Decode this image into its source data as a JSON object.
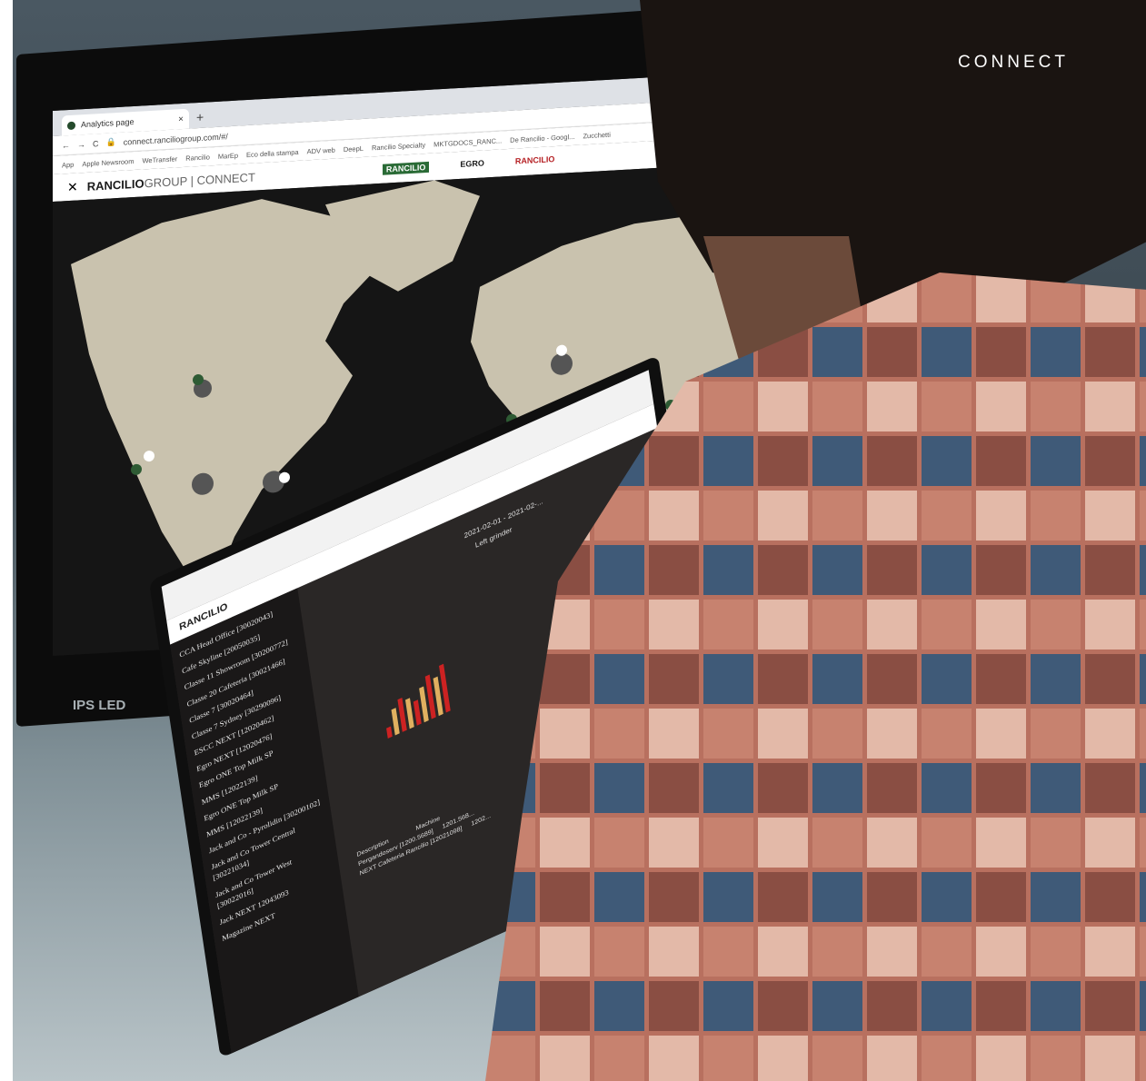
{
  "overlay": {
    "brand_word": "CONNECT"
  },
  "monitor": {
    "label": "IPS LED",
    "browser": {
      "tab_title": "Analytics page",
      "tab_close": "×",
      "new_tab": "+",
      "address": "connect.ranciliogroup.com/#/",
      "bookmarks": [
        "App",
        "Apple Newsroom",
        "WeTransfer",
        "Rancilio",
        "MarEp",
        "Eco della stampa",
        "ADV web",
        "DeepL",
        "Rancilio Specialty",
        "MKTGDOCS_RANC...",
        "De Rancilio - Googl...",
        "Zucchetti"
      ]
    },
    "site": {
      "logo_bold": "RANCILIO",
      "logo_light": "GROUP | CONNECT",
      "partners": [
        "RANCILIO",
        "EGRO",
        "RANCILIO"
      ]
    }
  },
  "laptop": {
    "logo": "RANCILIO",
    "sidebar_items": [
      "CCA Head Office [30020043]",
      "Cafe Skyline [20050035]",
      "Classe 11 Showroom [30200772]",
      "Classe 20 Cafeteria [30021466]",
      "Classe 7 [30020464]",
      "Classe 7 Sydney [30290096]",
      "ESCC NEXT [12020462]",
      "Egro NEXT [12020476]",
      "Egro ONE Top Milk SP",
      "MMS [12022139]",
      "Egro ONE Top Milk SP",
      "MMS [12022139]",
      "Jack and Co - Pyrolidin [30200102]",
      "Jack and Co Tower Central [30221034]",
      "Jack and Co Tower West [30022016]",
      "Jack NEXT 12043093",
      "Magazine NEXT"
    ],
    "chart_header": "2021-02-01 - 2021-02-...",
    "chart_sub": "Left grinder",
    "table_headers": [
      "Description",
      "Machine"
    ],
    "table_rows": [
      [
        "Pergandoserv [1200.5689]",
        "1201.568..."
      ],
      [
        "NEXT Cafeteria Rancilio [12021098]",
        "1202..."
      ]
    ]
  }
}
